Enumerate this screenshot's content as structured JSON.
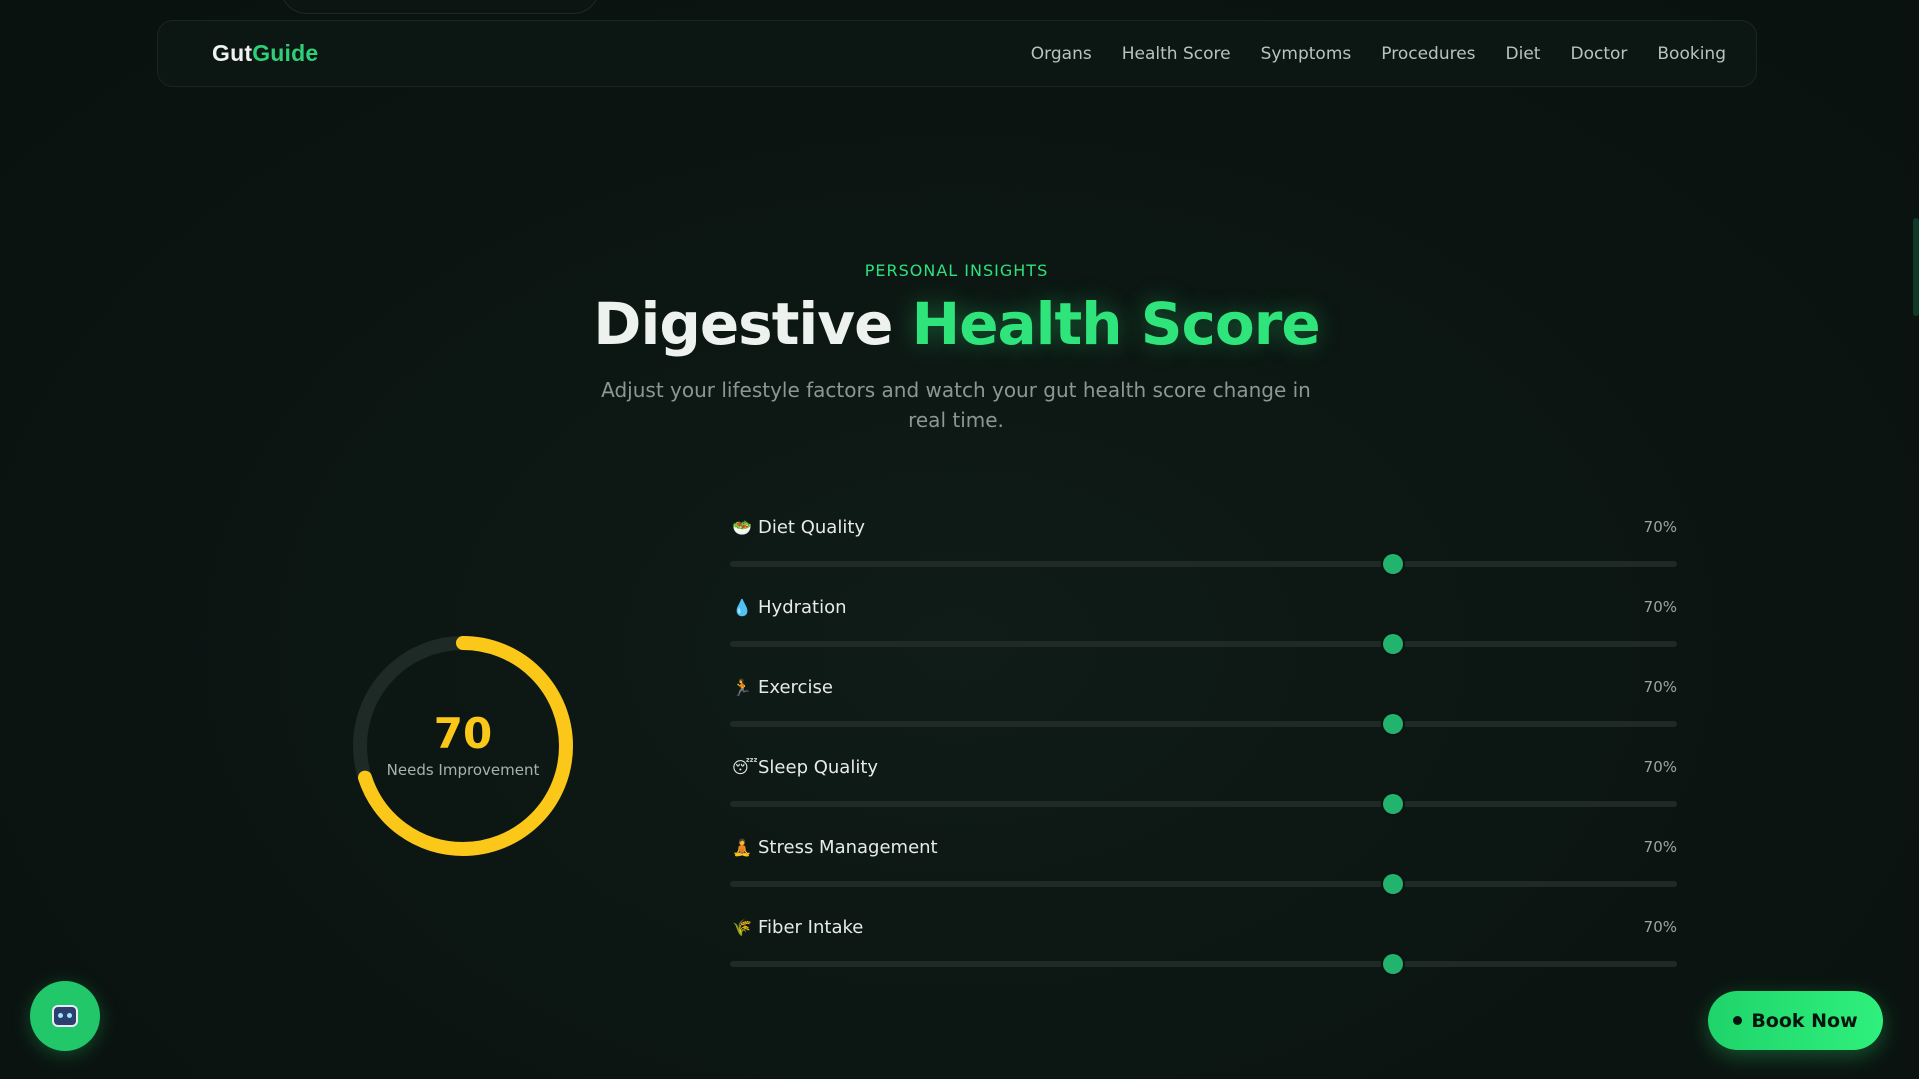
{
  "nav": {
    "logo_part1": "Gut",
    "logo_part2": "Guide",
    "links": [
      "Organs",
      "Health Score",
      "Symptoms",
      "Procedures",
      "Diet",
      "Doctor",
      "Booking"
    ]
  },
  "hero": {
    "eyebrow": "PERSONAL INSIGHTS",
    "title_part1": "Digestive",
    "title_part2": "Health Score",
    "subtitle": "Adjust your lifestyle factors and watch your gut health score change in real time."
  },
  "score": {
    "value": "70",
    "label": "Needs Improvement",
    "fraction": 0.7,
    "color": "#fbc81a"
  },
  "factors": [
    {
      "icon": "salad-bowl-icon",
      "glyph": "🥗",
      "label": "Diet Quality",
      "percent": "70%",
      "value": 0.7
    },
    {
      "icon": "water-drop-icon",
      "glyph": "💧",
      "label": "Hydration",
      "percent": "70%",
      "value": 0.7
    },
    {
      "icon": "running-icon",
      "glyph": "🏃",
      "label": "Exercise",
      "percent": "70%",
      "value": 0.7
    },
    {
      "icon": "sleeping-face-icon",
      "glyph": "😴",
      "label": "Sleep Quality",
      "percent": "70%",
      "value": 0.7
    },
    {
      "icon": "meditation-icon",
      "glyph": "🧘",
      "label": "Stress Management",
      "percent": "70%",
      "value": 0.7
    },
    {
      "icon": "wheat-icon",
      "glyph": "🌾",
      "label": "Fiber Intake",
      "percent": "70%",
      "value": 0.7
    }
  ],
  "buttons": {
    "book": "Book Now",
    "chatbot_icon": "robot-icon"
  },
  "colors": {
    "accent": "#2fe07e",
    "gauge": "#fbc81a",
    "slider_thumb": "#22b36e"
  }
}
